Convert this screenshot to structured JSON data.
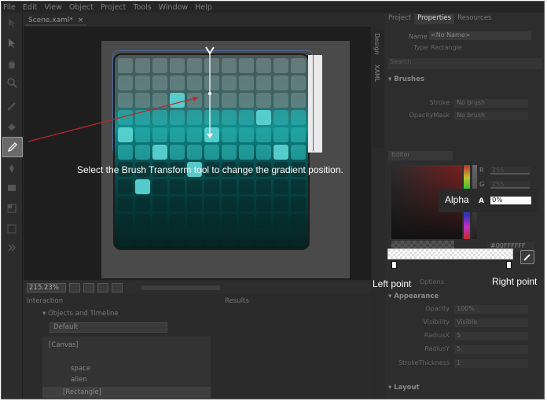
{
  "menu": [
    "File",
    "Edit",
    "View",
    "Object",
    "Project",
    "Tools",
    "Window",
    "Help"
  ],
  "document_tab": {
    "label": "Scene.xaml*",
    "close": "×"
  },
  "caption": "Select the Brush Transform tool to change the gradient position.",
  "vertical_tabs": [
    "Design",
    "XAML"
  ],
  "zoom": "215.23%",
  "bottom_panel": {
    "tab_interaction": "Interaction",
    "tab_results": "Results",
    "objects_header": "Objects and Timeline",
    "state": "Default",
    "tree": [
      "[Canvas]",
      "space",
      "alien",
      "[Rectangle]"
    ]
  },
  "right_panel": {
    "tabs": [
      "Project",
      "Properties",
      "Resources"
    ],
    "name_label": "Name",
    "name_value": "<No Name>",
    "type_label": "Type",
    "type_value": "Rectangle",
    "search": "Search",
    "brushes_header": "Brushes",
    "brush_rows": [
      {
        "key": "Stroke",
        "value": "No brush"
      },
      {
        "key": "OpacityMask",
        "value": "No brush"
      }
    ],
    "editor_tab": "Editor",
    "channels": [
      {
        "key": "R",
        "value": "255"
      },
      {
        "key": "G",
        "value": "255"
      },
      {
        "key": "B",
        "value": "255"
      }
    ],
    "alpha_key": "A",
    "alpha_value": "0%",
    "hex": "#00FFFFFF",
    "options": "Options",
    "appearance_header": "Appearance",
    "appearance_rows": [
      {
        "key": "Opacity",
        "value": "100%"
      },
      {
        "key": "Visibility",
        "value": "Visible"
      },
      {
        "key": "RadiusX",
        "value": "5"
      },
      {
        "key": "RadiusY",
        "value": "5"
      },
      {
        "key": "StrokeThickness",
        "value": "1"
      }
    ],
    "layout_header": "Layout"
  },
  "annotations": {
    "alpha": "Alpha",
    "left_point": "Left point",
    "right_point": "Right point"
  },
  "colors": {
    "teal": "#0f8e8e",
    "annotation_arrow": "#c0262a"
  }
}
